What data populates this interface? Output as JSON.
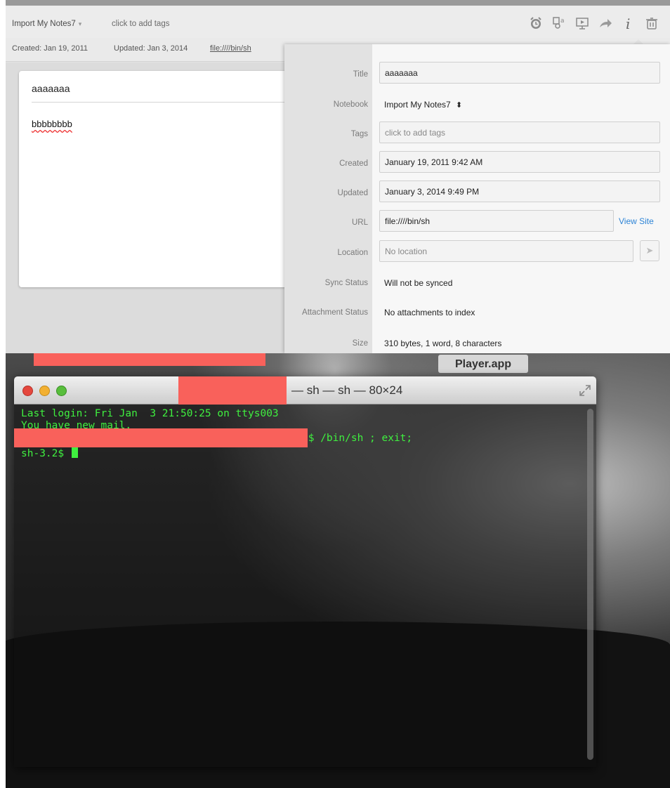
{
  "evernote": {
    "toolbar": {
      "notebook_label": "Import My Notes7",
      "notebook_caret": "▾",
      "tags_placeholder": "click to add tags",
      "icons": [
        "alarm-icon",
        "present-icon",
        "presentation-icon",
        "share-icon",
        "info-icon",
        "trash-icon"
      ]
    },
    "meta": {
      "created": "Created: Jan 19, 2011",
      "updated": "Updated: Jan 3, 2014",
      "url": "file:////bin/sh"
    },
    "note": {
      "title": "aaaaaaa",
      "body": "bbbbbbbb"
    },
    "info": {
      "title_label": "Title",
      "title_value": "aaaaaaa",
      "notebook_label": "Notebook",
      "notebook_value": "Import My Notes7",
      "tags_label": "Tags",
      "tags_placeholder": "click to add tags",
      "created_label": "Created",
      "created_value": "January 19, 2011 9:42 AM",
      "updated_label": "Updated",
      "updated_value": "January 3, 2014 9:49 PM",
      "url_label": "URL",
      "url_value": "file:////bin/sh",
      "view_site": "View Site",
      "location_label": "Location",
      "location_placeholder": "No location",
      "sync_label": "Sync Status",
      "sync_value": "Will not be synced",
      "attachment_label": "Attachment Status",
      "attachment_value": "No attachments to index",
      "size_label": "Size",
      "size_value": "310 bytes, 1 word, 8 characters"
    }
  },
  "desktop": {
    "player_label": "Player.app",
    "redaction_color": "#f9615b"
  },
  "terminal": {
    "title": "— sh — sh — 80×24",
    "lines": {
      "line1": "Last login: Fri Jan  3 21:50:25 on ttys003",
      "line2": "You have new mail.",
      "line3": "2$ /bin/sh ; exit;",
      "line4": "sh-3.2$ "
    },
    "text_color": "#3ff03f"
  }
}
